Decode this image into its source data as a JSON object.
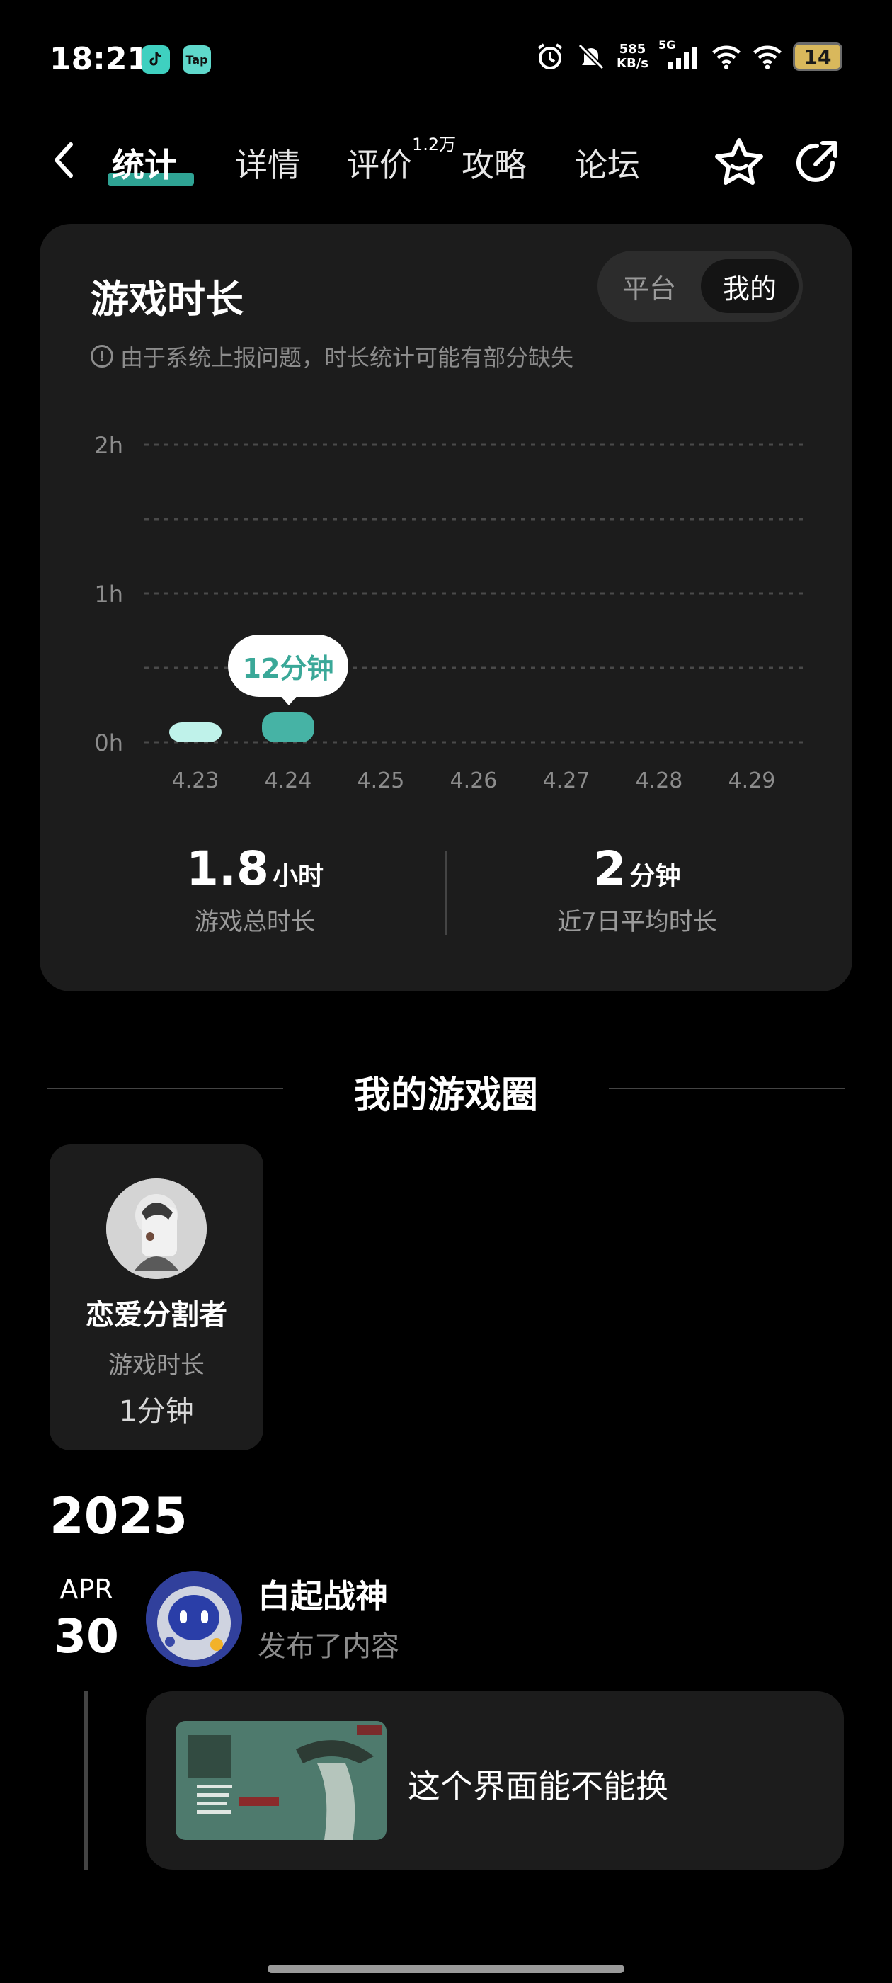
{
  "status_bar": {
    "time": "18:21",
    "app_icon_tiktok": "tiktok-icon",
    "app_icon_tap": "Tap",
    "net_speed_value": "585",
    "net_speed_unit": "KB/s",
    "network": "5G",
    "battery": "14"
  },
  "nav": {
    "tabs": [
      {
        "label": "统计",
        "active": true
      },
      {
        "label": "详情"
      },
      {
        "label": "评价",
        "badge": "1.2万"
      },
      {
        "label": "攻略"
      },
      {
        "label": "论坛"
      }
    ]
  },
  "playtime_card": {
    "title": "游戏时长",
    "toggle": [
      "平台",
      "我的"
    ],
    "toggle_selected": "我的",
    "notice": "由于系统上报问题，时长统计可能有部分缺失",
    "tooltip": "12分钟",
    "total_value": "1.8",
    "total_unit": "小时",
    "total_label": "游戏总时长",
    "avg_value": "2",
    "avg_unit": "分钟",
    "avg_label": "近7日平均时长"
  },
  "chart_data": {
    "type": "bar",
    "categories": [
      "4.23",
      "4.24",
      "4.25",
      "4.26",
      "4.27",
      "4.28",
      "4.29"
    ],
    "values": [
      7,
      12,
      0,
      0,
      0,
      0,
      0
    ],
    "unit": "minutes",
    "y_ticks": [
      "2h",
      "1h",
      "0h"
    ],
    "ylim": [
      0,
      120
    ],
    "grid": true,
    "colors": {
      "bar_light": "#bff2ea",
      "bar_selected": "#46b3a5",
      "tooltip_text": "#3aa898"
    }
  },
  "game_circle": {
    "title": "我的游戏圈",
    "member": {
      "name": "恋爱分割者",
      "stat_label": "游戏时长",
      "stat_value": "1分钟"
    }
  },
  "timeline": {
    "year": "2025",
    "month": "APR",
    "day": "30",
    "author": "白起战神",
    "action": "发布了内容",
    "post_text": "这个界面能不能换"
  }
}
